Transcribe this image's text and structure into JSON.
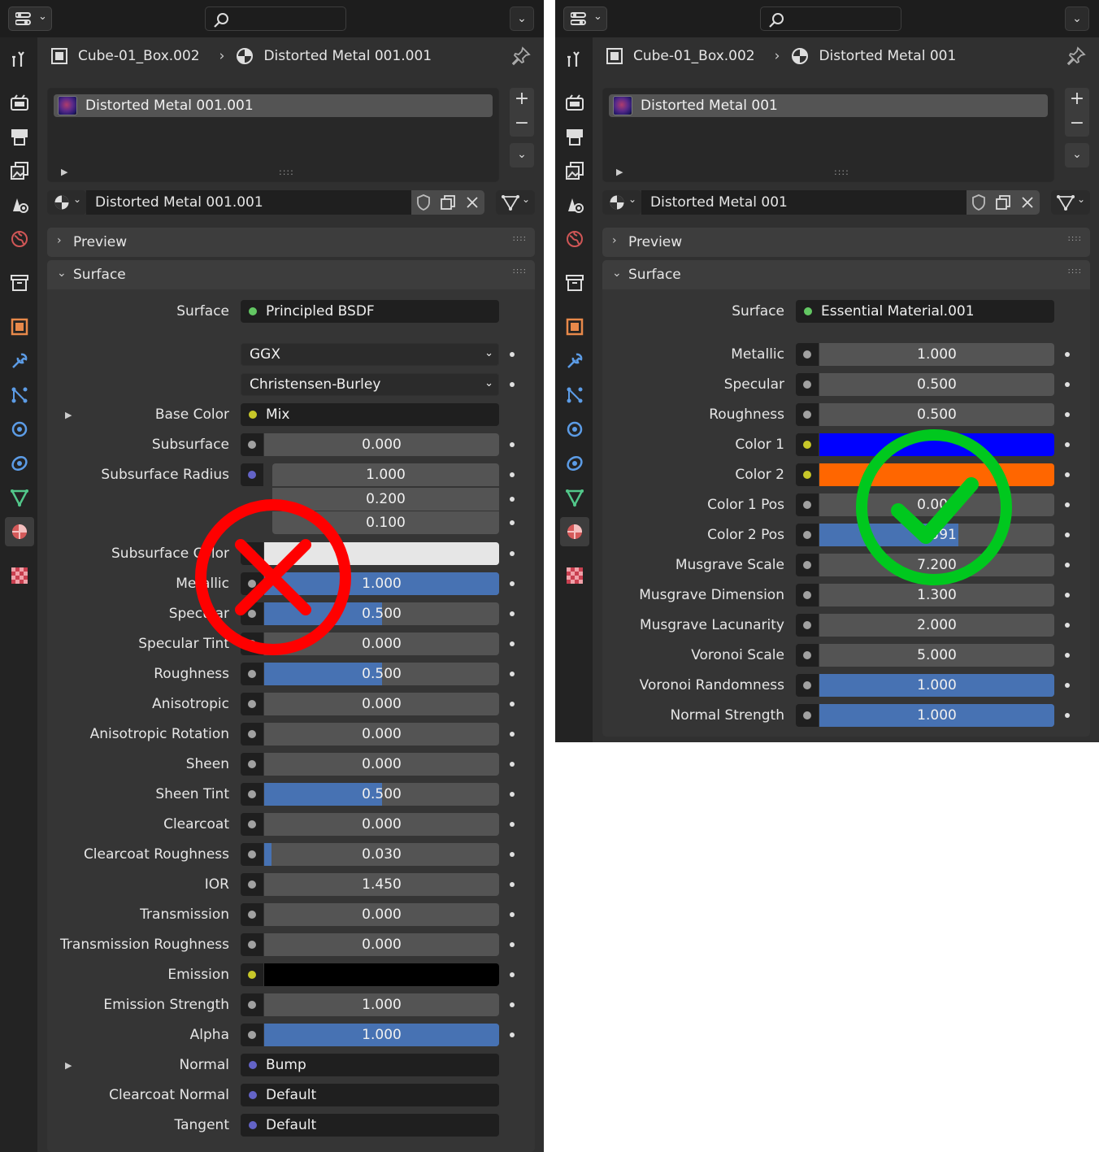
{
  "left": {
    "breadcrumb": {
      "object": "Cube-01_Box.002",
      "material": "Distorted Metal 001.001"
    },
    "slot_name": "Distorted Metal 001.001",
    "material_name": "Distorted Metal 001.001",
    "preview_label": "Preview",
    "surface_label": "Surface",
    "surface_shader_label": "Surface",
    "surface_shader_value": "Principled BSDF",
    "distribution": "GGX",
    "subsurface_method": "Christensen-Burley",
    "base_color": {
      "label": "Base Color",
      "value": "Mix"
    },
    "subsurface_radius": {
      "label": "Subsurface Radius",
      "values": [
        "1.000",
        "0.200",
        "0.100"
      ]
    },
    "subsurface_color_label": "Subsurface Color",
    "rows": [
      {
        "label": "Subsurface",
        "value": "0.000",
        "fill": 0
      },
      {
        "label": "Metallic",
        "value": "1.000",
        "fill": 1
      },
      {
        "label": "Specular",
        "value": "0.500",
        "fill": 0.5
      },
      {
        "label": "Specular Tint",
        "value": "0.000",
        "fill": 0
      },
      {
        "label": "Roughness",
        "value": "0.500",
        "fill": 0.5
      },
      {
        "label": "Anisotropic",
        "value": "0.000",
        "fill": 0
      },
      {
        "label": "Anisotropic Rotation",
        "value": "0.000",
        "fill": 0
      },
      {
        "label": "Sheen",
        "value": "0.000",
        "fill": 0
      },
      {
        "label": "Sheen Tint",
        "value": "0.500",
        "fill": 0.5
      },
      {
        "label": "Clearcoat",
        "value": "0.000",
        "fill": 0
      },
      {
        "label": "Clearcoat Roughness",
        "value": "0.030",
        "fill": 0.03
      },
      {
        "label": "IOR",
        "value": "1.450",
        "fill": 0
      },
      {
        "label": "Transmission",
        "value": "0.000",
        "fill": 0
      },
      {
        "label": "Transmission Roughness",
        "value": "0.000",
        "fill": 0
      },
      {
        "label": "Emission Strength",
        "value": "1.000",
        "fill": 0
      },
      {
        "label": "Alpha",
        "value": "1.000",
        "fill": 1
      }
    ],
    "emission_label": "Emission",
    "normal": {
      "label": "Normal",
      "value": "Bump"
    },
    "clearcoat_normal": {
      "label": "Clearcoat Normal",
      "value": "Default"
    },
    "tangent": {
      "label": "Tangent",
      "value": "Default"
    }
  },
  "right": {
    "breadcrumb": {
      "object": "Cube-01_Box.002",
      "material": "Distorted Metal 001"
    },
    "slot_name": "Distorted Metal 001",
    "material_name": "Distorted Metal 001",
    "preview_label": "Preview",
    "surface_label": "Surface",
    "surface_shader_label": "Surface",
    "surface_shader_value": "Essential Material.001",
    "rows": [
      {
        "label": "Metallic",
        "value": "1.000",
        "fill": 0,
        "kind": "num"
      },
      {
        "label": "Specular",
        "value": "0.500",
        "fill": 0,
        "kind": "num"
      },
      {
        "label": "Roughness",
        "value": "0.500",
        "fill": 0,
        "kind": "num"
      },
      {
        "label": "Color 1",
        "value": "",
        "color": "#0000ff",
        "kind": "color"
      },
      {
        "label": "Color 2",
        "value": "",
        "color": "#ff6600",
        "kind": "color"
      },
      {
        "label": "Color 1 Pos",
        "value": "0.000",
        "fill": 0,
        "kind": "num"
      },
      {
        "label": "Color 2 Pos",
        "value": "0.591",
        "fill": 0.591,
        "kind": "num"
      },
      {
        "label": "Musgrave Scale",
        "value": "7.200",
        "fill": 0,
        "kind": "num"
      },
      {
        "label": "Musgrave Dimension",
        "value": "1.300",
        "fill": 0,
        "kind": "num"
      },
      {
        "label": "Musgrave Lacunarity",
        "value": "2.000",
        "fill": 0,
        "kind": "num"
      },
      {
        "label": "Voronoi Scale",
        "value": "5.000",
        "fill": 0,
        "kind": "num"
      },
      {
        "label": "Voronoi Randomness",
        "value": "1.000",
        "fill": 1,
        "kind": "num"
      },
      {
        "label": "Normal Strength",
        "value": "1.000",
        "fill": 1,
        "kind": "num"
      }
    ]
  },
  "colors": {
    "accent": "#4772b3",
    "socket_gray": "#a1a1a1",
    "socket_yellow": "#c7c729",
    "socket_blue": "#6363c7",
    "socket_green": "#63c763",
    "cross": "#ff0000",
    "check": "#00c81e",
    "emission": "#000000",
    "subsurface_color": "#e6e6e6"
  }
}
